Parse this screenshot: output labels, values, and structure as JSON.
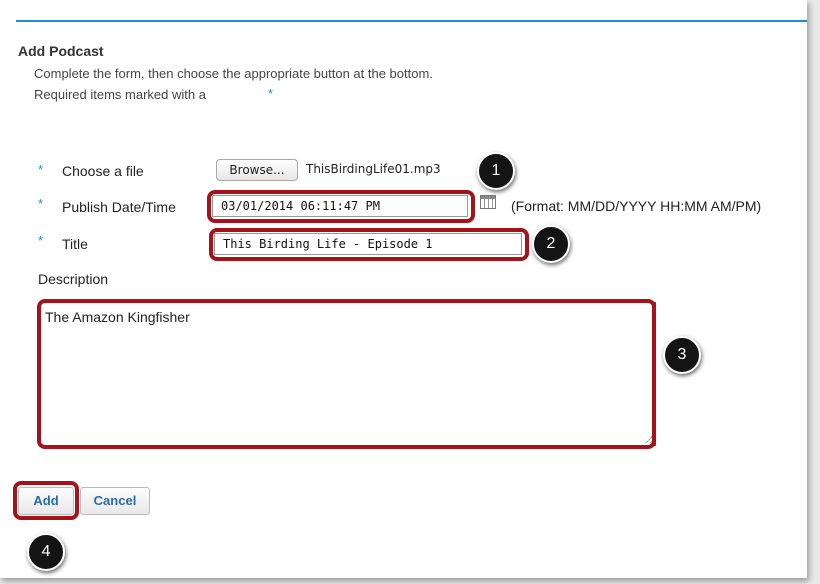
{
  "form": {
    "heading": "Add Podcast",
    "instruction_line1": "Complete the form, then choose the appropriate button at the bottom.",
    "instruction_line2": "Required items marked with a",
    "required_marker": "*"
  },
  "fields": {
    "file": {
      "label": "Choose a file",
      "browse_label": "Browse...",
      "filename": "ThisBirdingLife01.mp3"
    },
    "publish": {
      "label": "Publish Date/Time",
      "value": "03/01/2014 06:11:47 PM",
      "format_hint": "(Format: MM/DD/YYYY HH:MM AM/PM)"
    },
    "title": {
      "label": "Title",
      "value": "This Birding Life - Episode 1"
    },
    "description": {
      "label": "Description",
      "value": "The Amazon Kingfisher"
    }
  },
  "buttons": {
    "add": "Add",
    "cancel": "Cancel"
  },
  "callouts": [
    "1",
    "2",
    "3",
    "4"
  ],
  "colors": {
    "accent": "#1a8fd0",
    "highlight": "#a5121a",
    "badge": "#141414",
    "link_button_text": "#2a6aa8"
  }
}
